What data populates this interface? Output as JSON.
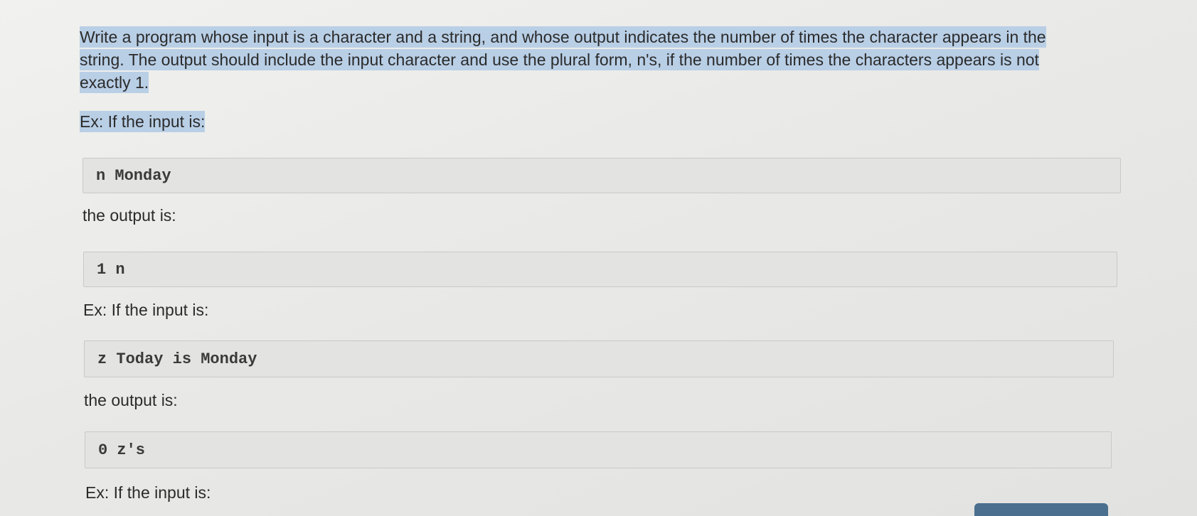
{
  "problem": {
    "description": "Write a program whose input is a character and a string, and whose output indicates the number of times the character appears in the string. The output should include the input character and use the plural form, n's, if the number of times the characters appears is not exactly 1.",
    "examples": [
      {
        "input_label": "Ex: If the input is:",
        "input": "n Monday",
        "output_label": "the output is:",
        "output": "1 n"
      },
      {
        "input_label": "Ex: If the input is:",
        "input": "z Today is Monday",
        "output_label": "the output is:",
        "output": "0 z's"
      },
      {
        "input_label": "Ex: If the input is:"
      }
    ]
  },
  "colors": {
    "selection_highlight": "#b9cfe6",
    "code_background": "#e3e3e1",
    "button_partial": "#4a6f8f"
  }
}
